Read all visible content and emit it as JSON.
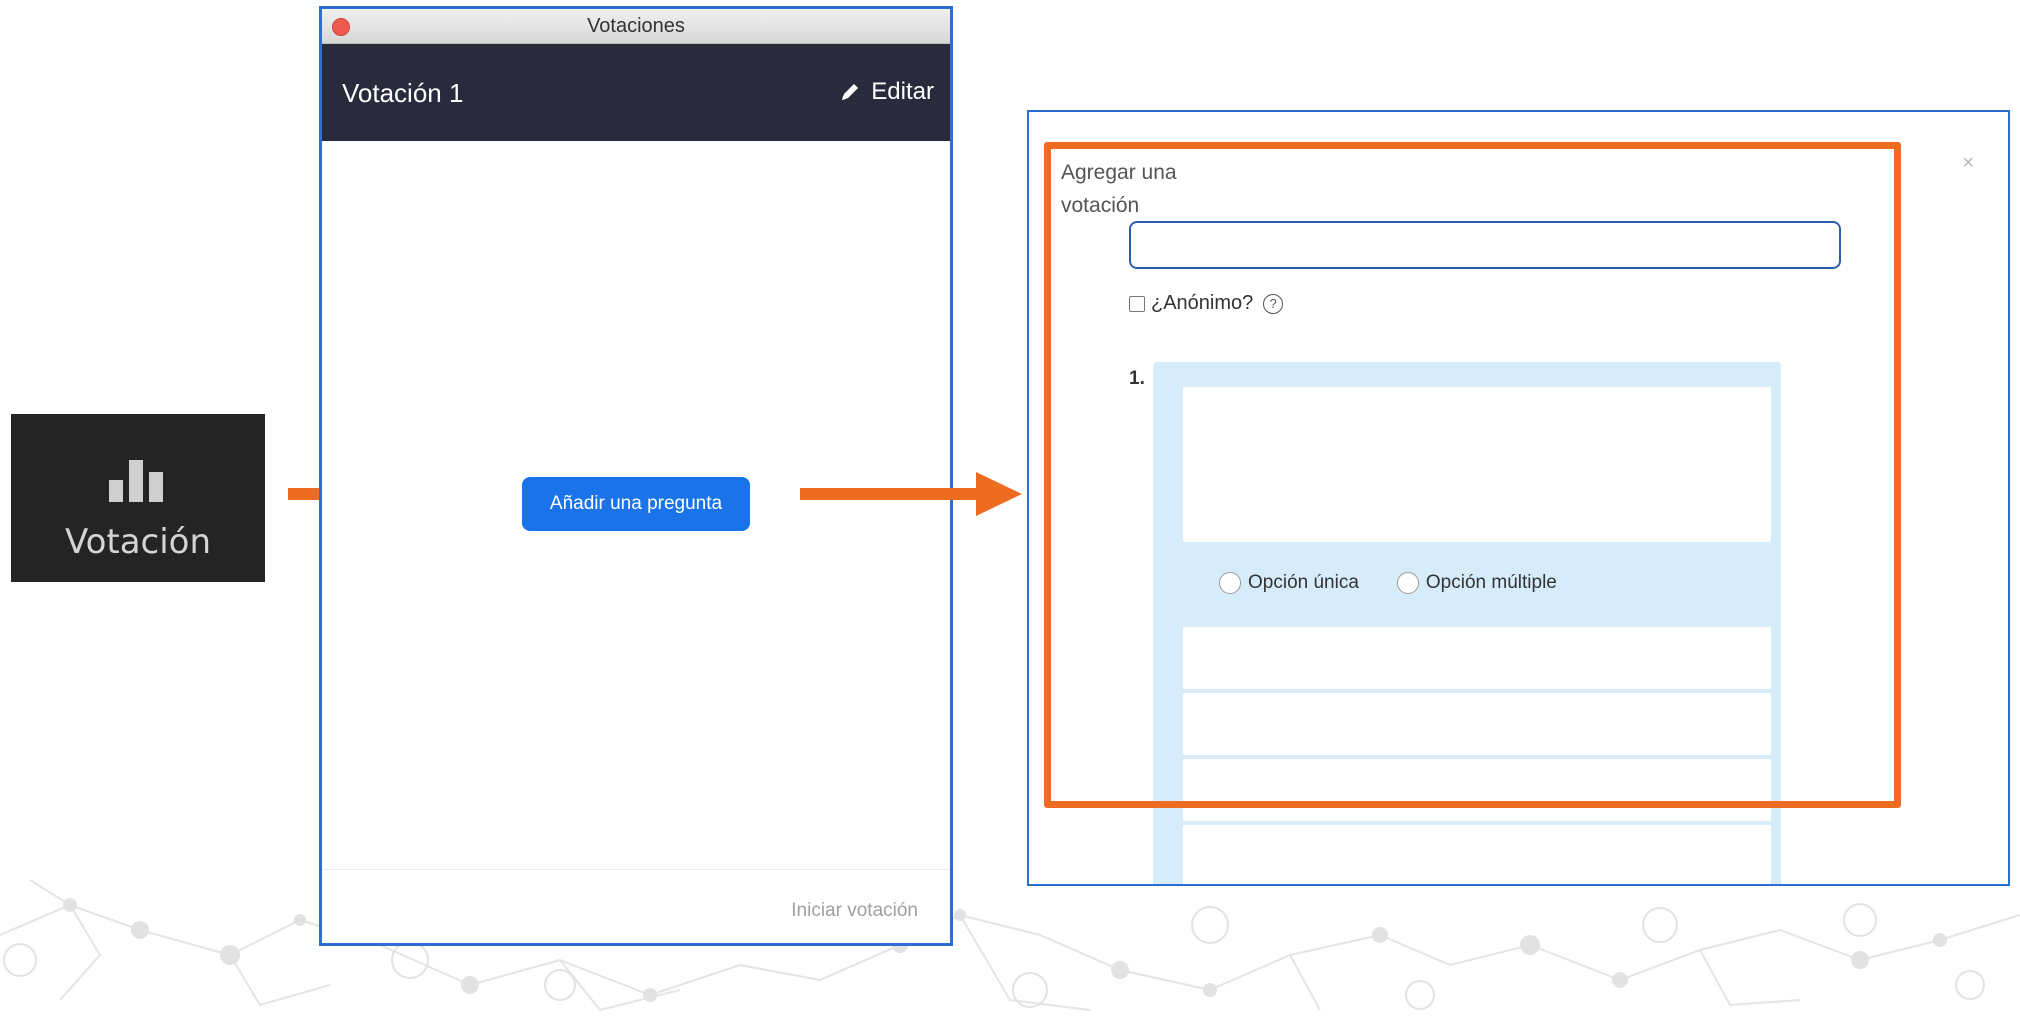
{
  "toolbar_button": {
    "label": "Votación",
    "icon": "bar-chart-icon"
  },
  "poll_window": {
    "title": "Votaciones",
    "poll_name": "Votación 1",
    "edit_label": "Editar",
    "edit_icon": "pencil-icon",
    "add_question_label": "Añadir una pregunta",
    "start_poll_label": "Iniciar votación"
  },
  "add_poll_dialog": {
    "title": "Agregar una votación",
    "poll_name_value": "",
    "anonymous_label": "¿Anónimo?",
    "anonymous_checked": false,
    "question_number": "1.",
    "question_text": "",
    "single_choice_label": "Opción única",
    "multiple_choice_label": "Opción múltiple",
    "answers": [
      "",
      "",
      "",
      ""
    ]
  },
  "colors": {
    "arrow": "#ee6b22",
    "highlight": "#ee6b22",
    "header_bg": "#292b3d",
    "primary_button": "#1a73e8",
    "question_card_bg": "#d6ecfb",
    "window_border": "#2b6fd1"
  }
}
